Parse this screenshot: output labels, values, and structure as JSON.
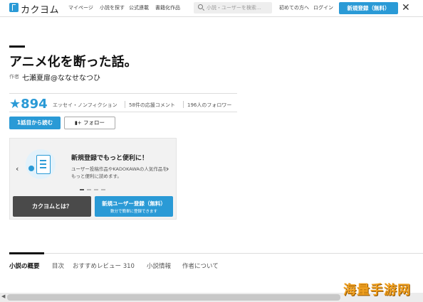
{
  "header": {
    "logo_text": "カクヨム",
    "nav": [
      "マイページ",
      "小説を探す",
      "公式連載",
      "書籍化作品"
    ],
    "search_placeholder": "小説・ユーザーを検索…",
    "first_time": "初めての方へ",
    "login": "ログイン",
    "register": "新規登録（無料）",
    "close": "✕"
  },
  "work": {
    "title": "アニメ化を断った話。",
    "author_label": "作者",
    "author": "七瀬夏扉@ななせなつひ",
    "rating": "★894",
    "genre": "エッセイ・ノンフィクション",
    "comments": "58件の応援コメント",
    "followers": "196人のフォロワー"
  },
  "actions": {
    "read_first": "1話目から読む",
    "follow": "フォロー"
  },
  "promo": {
    "title": "新規登録でもっと便利に！",
    "desc": "ユーザー投稿作品やKADOKAWAの人気作品をもっと便利に読めます。",
    "about": "カクヨムとは？",
    "register_main": "新規ユーザー登録（無料）",
    "register_sub": "数分で簡単に登録できます"
  },
  "tabs": [
    "小説の概要",
    "目次",
    "おすすめレビュー 310",
    "小説情報",
    "作者について"
  ],
  "watermark": "海量手游网",
  "colors": {
    "accent": "#2a9ad6",
    "dark": "#4a4a4a"
  }
}
